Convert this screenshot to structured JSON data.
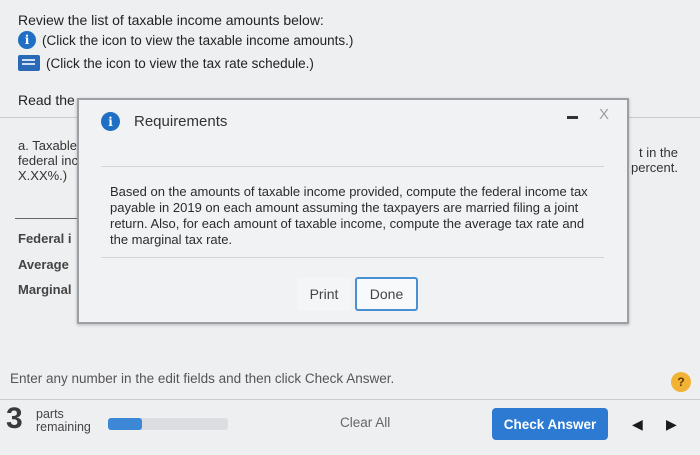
{
  "intro": "Review the list of taxable income amounts below:",
  "links": {
    "income": "(Click the icon to view the taxable income amounts.)",
    "rates": "(Click the icon to view the tax rate schedule.)"
  },
  "background": {
    "read_the": "Read the",
    "partial_a1": "a. Taxable",
    "partial_a2": "federal inc",
    "partial_a3": "X.XX%.)",
    "partial_right1": "t in the",
    "partial_right2": "percent.",
    "row_federal": "Federal i",
    "row_average": "Average",
    "row_marginal": "Marginal"
  },
  "modal": {
    "info_glyph": "i",
    "title": "Requirements",
    "close": "X",
    "body": "Based on the amounts of taxable income provided, compute the federal income tax payable in 2019 on each amount assuming the taxpayers are married filing a joint return. Also, for each amount of taxable income, compute the average tax rate and the marginal tax rate.",
    "print_label": "Print",
    "done_label": "Done"
  },
  "footer": {
    "instruction": "Enter any number in the edit fields and then click Check Answer.",
    "help": "?",
    "parts_count": "3",
    "parts_label_1": "parts",
    "parts_label_2": "remaining",
    "progress_fraction": 0.28,
    "clear_all": "Clear All",
    "check_answer": "Check Answer",
    "prev": "◀",
    "next": "▶"
  },
  "colors": {
    "accent": "#2c7ad2",
    "info_icon": "#1f6fc5",
    "help_icon": "#f2b233"
  }
}
